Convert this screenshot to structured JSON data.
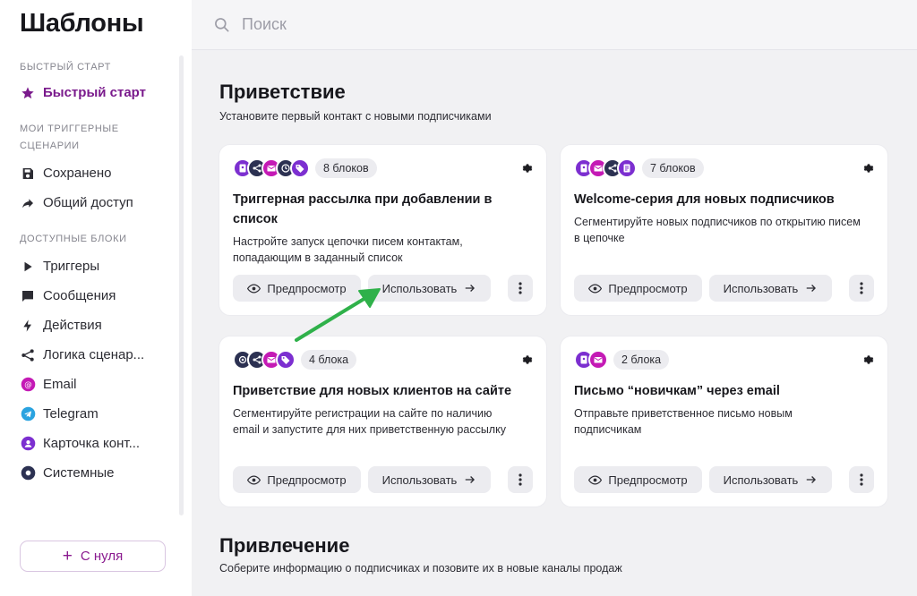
{
  "sidebar": {
    "title": "Шаблоны",
    "sections": [
      {
        "label": "БЫСТРЫЙ СТАРТ",
        "items": [
          {
            "label": "Быстрый старт",
            "icon": "star-icon",
            "active": true
          }
        ]
      },
      {
        "label": "МОИ ТРИГГЕРНЫЕ СЦЕНАРИИ",
        "items": [
          {
            "label": "Сохранено",
            "icon": "save-icon"
          },
          {
            "label": "Общий доступ",
            "icon": "share-arrow-icon"
          }
        ]
      },
      {
        "label": "ДОСТУПНЫЕ БЛОКИ",
        "items": [
          {
            "label": "Триггеры",
            "icon": "play-icon"
          },
          {
            "label": "Сообщения",
            "icon": "chat-icon"
          },
          {
            "label": "Действия",
            "icon": "lightning-icon"
          },
          {
            "label": "Логика сценар...",
            "icon": "branch-icon"
          },
          {
            "label": "Email",
            "icon": "email-at-icon"
          },
          {
            "label": "Telegram",
            "icon": "telegram-icon"
          },
          {
            "label": "Карточка конт...",
            "icon": "contact-card-icon"
          },
          {
            "label": "Системные",
            "icon": "system-icon"
          }
        ]
      }
    ],
    "new_button": "С нуля"
  },
  "search": {
    "placeholder": "Поиск"
  },
  "sections": [
    {
      "title": "Приветствие",
      "subtitle": "Установите первый контакт с новыми подписчиками",
      "cards": [
        {
          "badge": "8 блоков",
          "title": "Триггерная рассылка при добавлении в список",
          "description": "Настройте запуск цепочки писем контактам, попадающим в заданный список",
          "icons": [
            "purple",
            "navy",
            "magenta",
            "navy",
            "purple"
          ]
        },
        {
          "badge": "7 блоков",
          "title": "Welcome-серия для новых подписчиков",
          "description": "Сегментируйте новых подписчиков по открытию писем в цепочке",
          "icons": [
            "purple",
            "magenta",
            "navy",
            "purple"
          ]
        },
        {
          "badge": "4 блока",
          "title": "Приветствие для новых клиентов на сайте",
          "description": "Сегментируйте регистрации на сайте по наличию email и запустите для них приветственную рассылку",
          "icons": [
            "navy",
            "navy",
            "magenta",
            "purple"
          ]
        },
        {
          "badge": "2 блока",
          "title": "Письмо “новичкам” через email",
          "description": "Отправьте приветственное письмо новым подписчикам",
          "icons": [
            "purple",
            "magenta"
          ]
        }
      ]
    },
    {
      "title": "Привлечение",
      "subtitle": "Соберите информацию о подписчиках и позовите их в новые каналы продаж"
    }
  ],
  "actions": {
    "preview": "Предпросмотр",
    "use": "Использовать"
  },
  "colors": {
    "accent": "#7a1a8c",
    "purple": "#7c2fd0",
    "magenta": "#c41ab5",
    "navy": "#2c3152",
    "arrow": "#2fb14a"
  }
}
